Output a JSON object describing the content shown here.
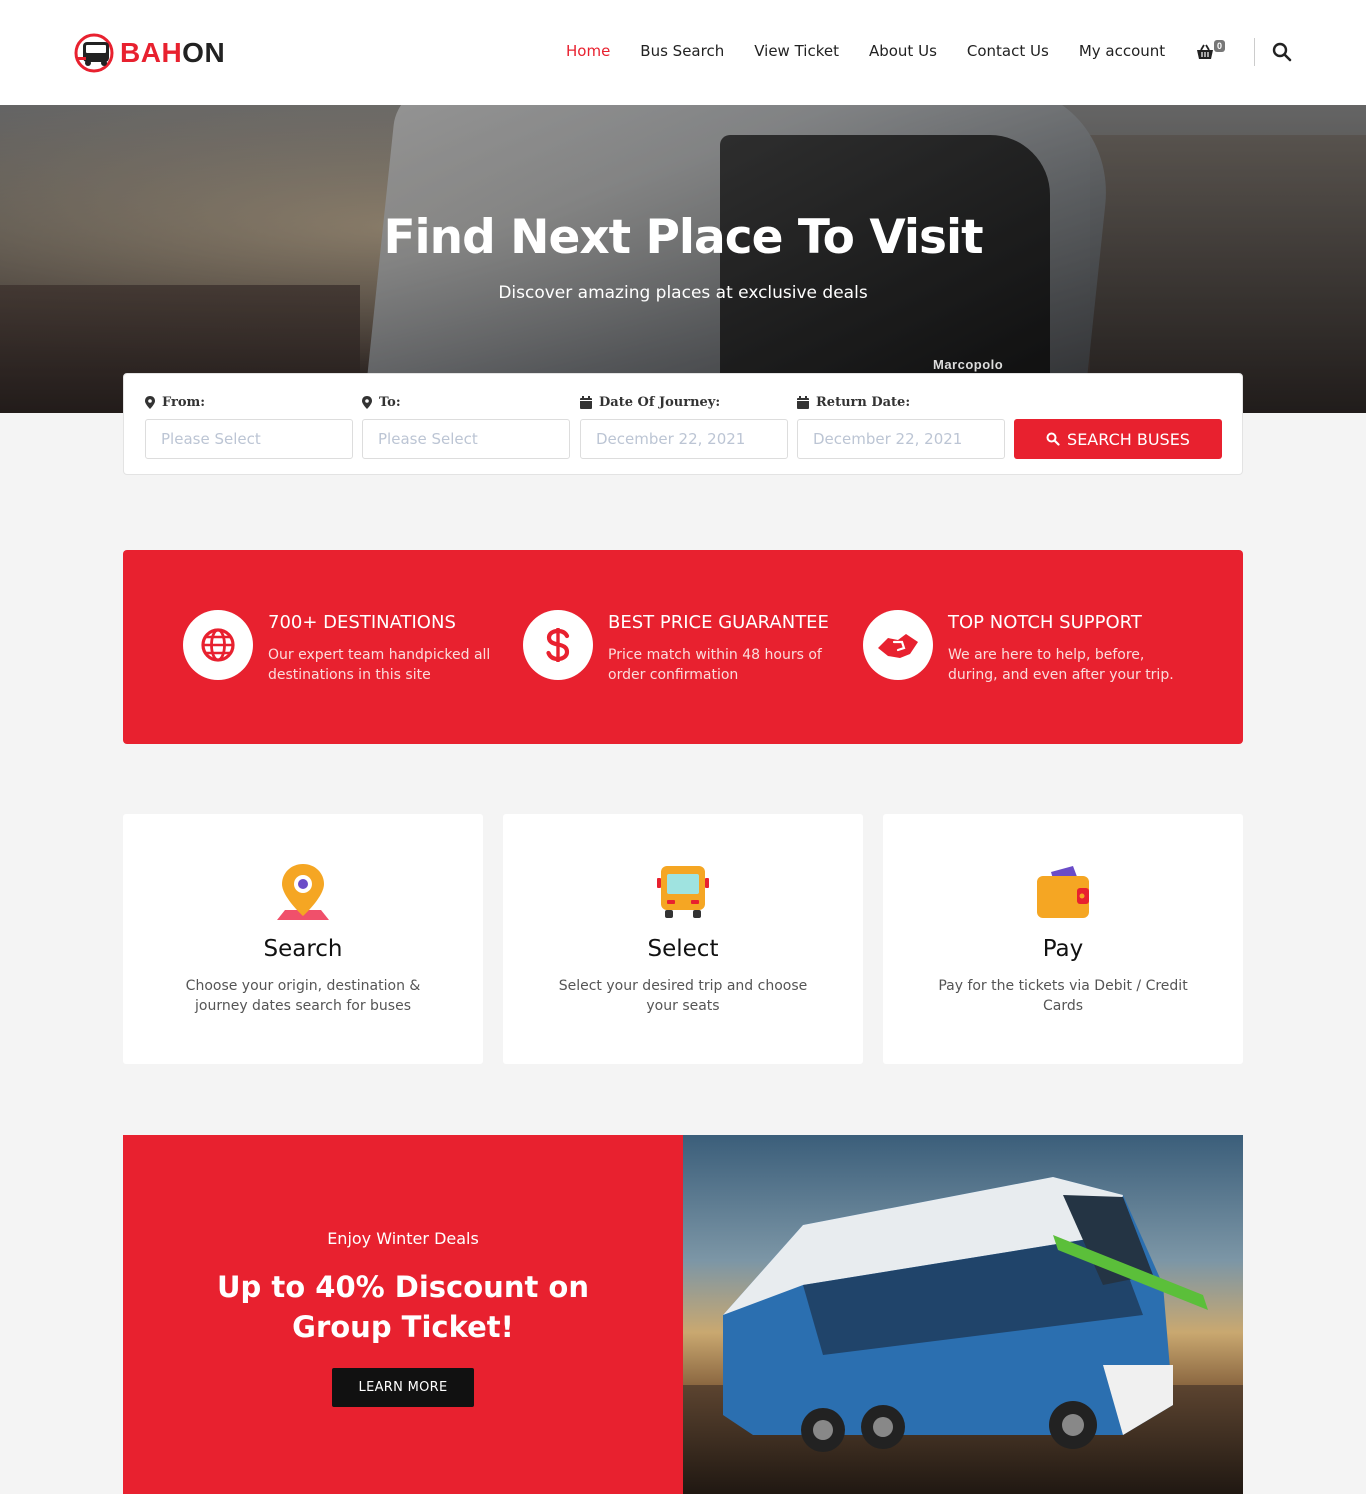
{
  "brand": {
    "part1": "BAH",
    "part2": "ON",
    "accent": "#e8212f"
  },
  "nav": {
    "items": [
      "Home",
      "Bus Search",
      "View Ticket",
      "About Us",
      "Contact Us",
      "My account"
    ],
    "active": "Home",
    "cart_count": "0"
  },
  "hero": {
    "title": "Find Next Place To Visit",
    "subtitle": "Discover amazing places at exclusive deals",
    "bus_brand": "Marcopolo"
  },
  "search_form": {
    "from_label": "From:",
    "from_placeholder": "Please Select",
    "to_label": "To:",
    "to_placeholder": "Please Select",
    "journey_label": "Date Of Journey:",
    "journey_value": "December 22, 2021",
    "return_label": "Return Date:",
    "return_value": "December 22, 2021",
    "button_label": "SEARCH BUSES"
  },
  "features": [
    {
      "icon": "globe-icon",
      "title": "700+ DESTINATIONS",
      "text": "Our expert team handpicked all destinations in this site"
    },
    {
      "icon": "dollar-icon",
      "title": "BEST PRICE GUARANTEE",
      "text": "Price match within 48 hours of order confirmation"
    },
    {
      "icon": "handshake-icon",
      "title": "TOP NOTCH SUPPORT",
      "text": "We are here to help, before, during, and even after your trip."
    }
  ],
  "steps": [
    {
      "icon": "map-pin-icon",
      "title": "Search",
      "text": "Choose your origin, destination & journey dates search for buses"
    },
    {
      "icon": "bus-icon",
      "title": "Select",
      "text": "Select your desired trip and choose your seats"
    },
    {
      "icon": "wallet-icon",
      "title": "Pay",
      "text": "Pay for the tickets via Debit / Credit Cards"
    }
  ],
  "promo": {
    "eyebrow": "Enjoy Winter Deals",
    "title": "Up to 40% Discount on Group Ticket!",
    "button_label": "LEARN MORE"
  }
}
